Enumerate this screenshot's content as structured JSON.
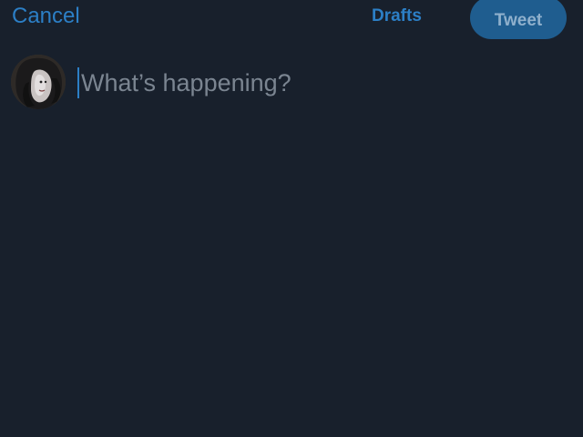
{
  "header": {
    "cancel_label": "Cancel",
    "drafts_label": "Drafts",
    "tweet_label": "Tweet"
  },
  "composer": {
    "placeholder": "What’s happening?"
  },
  "colors": {
    "background": "#18202c",
    "accent": "#2c7fc6",
    "tweet_button_bg": "#1f5d8f",
    "tweet_button_text": "#8fb0cc",
    "placeholder_text": "#7b8591"
  },
  "icons": {
    "avatar": "user-avatar"
  }
}
